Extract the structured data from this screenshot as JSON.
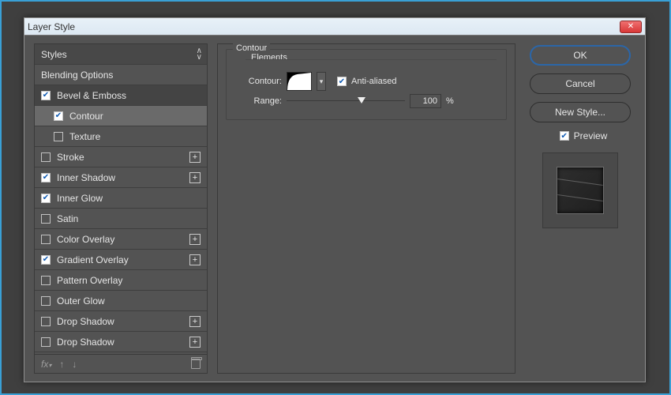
{
  "window": {
    "title": "Layer Style"
  },
  "buttons": {
    "ok": "OK",
    "cancel": "Cancel",
    "newstyle": "New Style...",
    "preview": "Preview"
  },
  "contour": {
    "group_title": "Contour",
    "sub_title": "Elements",
    "label_contour": "Contour:",
    "label_range": "Range:",
    "antialiased": "Anti-aliased",
    "range_value": "100",
    "range_unit": "%"
  },
  "styles": {
    "header": "Styles",
    "items": [
      {
        "label": "Blending Options",
        "indent": false,
        "cb": null,
        "plus": false,
        "selected": false
      },
      {
        "label": "Bevel & Emboss",
        "indent": false,
        "cb": true,
        "plus": false,
        "selected": "dark"
      },
      {
        "label": "Contour",
        "indent": true,
        "cb": true,
        "plus": false,
        "selected": true
      },
      {
        "label": "Texture",
        "indent": true,
        "cb": false,
        "plus": false,
        "selected": false
      },
      {
        "label": "Stroke",
        "indent": false,
        "cb": false,
        "plus": true,
        "selected": false
      },
      {
        "label": "Inner Shadow",
        "indent": false,
        "cb": true,
        "plus": true,
        "selected": false
      },
      {
        "label": "Inner Glow",
        "indent": false,
        "cb": true,
        "plus": false,
        "selected": false
      },
      {
        "label": "Satin",
        "indent": false,
        "cb": false,
        "plus": false,
        "selected": false
      },
      {
        "label": "Color Overlay",
        "indent": false,
        "cb": false,
        "plus": true,
        "selected": false
      },
      {
        "label": "Gradient Overlay",
        "indent": false,
        "cb": true,
        "plus": true,
        "selected": false
      },
      {
        "label": "Pattern Overlay",
        "indent": false,
        "cb": false,
        "plus": false,
        "selected": false
      },
      {
        "label": "Outer Glow",
        "indent": false,
        "cb": false,
        "plus": false,
        "selected": false
      },
      {
        "label": "Drop Shadow",
        "indent": false,
        "cb": false,
        "plus": true,
        "selected": false
      },
      {
        "label": "Drop Shadow",
        "indent": false,
        "cb": false,
        "plus": true,
        "selected": false
      }
    ]
  }
}
